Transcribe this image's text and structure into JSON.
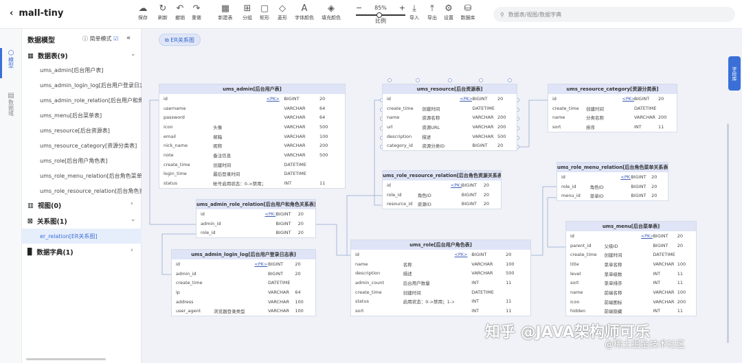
{
  "app": {
    "title": "mall-tiny"
  },
  "toolbar": [
    {
      "label": "保存",
      "icon": "cloud-save-icon",
      "glyph": "☁"
    },
    {
      "label": "刷新",
      "icon": "refresh-icon",
      "glyph": "↻"
    },
    {
      "label": "撤销",
      "icon": "undo-icon",
      "glyph": "↶"
    },
    {
      "label": "重做",
      "icon": "redo-icon",
      "glyph": "↷"
    },
    {
      "label": "新建表",
      "icon": "new-table-icon",
      "glyph": "▦"
    },
    {
      "label": "分组",
      "icon": "group-icon",
      "glyph": "⊞"
    },
    {
      "label": "矩形",
      "icon": "rect-icon",
      "glyph": "▢"
    },
    {
      "label": "菱形",
      "icon": "diamond-icon",
      "glyph": "◇"
    },
    {
      "label": "字体颜色",
      "icon": "font-color-icon",
      "glyph": "A"
    },
    {
      "label": "填充颜色",
      "icon": "fill-color-icon",
      "glyph": "◈"
    },
    {
      "label": "导入",
      "icon": "import-icon",
      "glyph": "⤓"
    },
    {
      "label": "导出",
      "icon": "export-icon",
      "glyph": "⤒"
    },
    {
      "label": "设置",
      "icon": "settings-icon",
      "glyph": "⚙"
    },
    {
      "label": "数据库",
      "icon": "database-icon",
      "glyph": "⛁"
    }
  ],
  "zoom": {
    "value": "85%",
    "label": "比例",
    "minus": "−",
    "plus": "+"
  },
  "search": {
    "placeholder": "数据表/视图/数据字典"
  },
  "rail": {
    "model": "模型",
    "dict": "数据域"
  },
  "panel": {
    "title": "数据模型",
    "simple_mode": "简单模式",
    "tables_section": "数据表(9)",
    "tables": [
      "ums_admin[后台用户表]",
      "ums_admin_login_log[后台用户登录日志表]",
      "ums_admin_role_relation[后台用户和角色关系表]",
      "ums_menu[后台菜单表]",
      "ums_resource[后台资源表]",
      "ums_resource_category[资源分类表]",
      "ums_role[后台用户角色表]",
      "ums_role_menu_relation[后台角色菜单关系表]",
      "ums_role_resource_relation[后台角色资源关系表]"
    ],
    "views_section": "视图(0)",
    "relations_section": "关系图(1)",
    "relations": [
      "er_relation[ER关系图]"
    ],
    "dict_section": "数据字典(1)"
  },
  "canvas": {
    "er_tab": "ER关系图",
    "field_lib": "字段库"
  },
  "watermark": {
    "line1": "知乎 @JAVA架构师可乐",
    "line2": "@稀土掘金技术社区"
  },
  "tables": [
    {
      "name": "ums_admin[后台用户表]",
      "rows": [
        [
          "id",
          "",
          "<PK>",
          "BIGINT",
          "20"
        ],
        [
          "username",
          "",
          "",
          "VARCHAR",
          "64"
        ],
        [
          "password",
          "",
          "",
          "VARCHAR",
          "64"
        ],
        [
          "icon",
          "头像",
          "",
          "VARCHAR",
          "500"
        ],
        [
          "email",
          "邮箱",
          "",
          "VARCHAR",
          "100"
        ],
        [
          "nick_name",
          "昵称",
          "",
          "VARCHAR",
          "200"
        ],
        [
          "note",
          "备注信息",
          "",
          "VARCHAR",
          "500"
        ],
        [
          "create_time",
          "创建时间",
          "",
          "DATETIME",
          ""
        ],
        [
          "login_time",
          "最后登录时间",
          "",
          "DATETIME",
          ""
        ],
        [
          "status",
          "帐号启用状态：0->禁用；1->启用",
          "",
          "INT",
          "11"
        ]
      ]
    },
    {
      "name": "ums_resource[后台资源表]",
      "rows": [
        [
          "id",
          "",
          "<PK>",
          "BIGINT",
          "20"
        ],
        [
          "create_time",
          "创建时间",
          "",
          "DATETIME",
          ""
        ],
        [
          "name",
          "资源名称",
          "",
          "VARCHAR",
          "200"
        ],
        [
          "url",
          "资源URL",
          "",
          "VARCHAR",
          "200"
        ],
        [
          "description",
          "描述",
          "",
          "VARCHAR",
          "500"
        ],
        [
          "category_id",
          "资源分类ID",
          "",
          "BIGINT",
          "20"
        ]
      ]
    },
    {
      "name": "ums_resource_category[资源分类表]",
      "rows": [
        [
          "id",
          "",
          "<PK>",
          "BIGINT",
          "20"
        ],
        [
          "create_time",
          "创建时间",
          "",
          "DATETIME",
          ""
        ],
        [
          "name",
          "分类名称",
          "",
          "VARCHAR",
          "200"
        ],
        [
          "sort",
          "排序",
          "",
          "INT",
          "11"
        ]
      ]
    },
    {
      "name": "ums_role_resource_relation[后台角色资源关系表]",
      "rows": [
        [
          "id",
          "",
          "<PK>",
          "BIGINT",
          "20"
        ],
        [
          "role_id",
          "角色ID",
          "",
          "BIGINT",
          "20"
        ],
        [
          "resource_id",
          "资源ID",
          "",
          "BIGINT",
          "20"
        ]
      ]
    },
    {
      "name": "ums_role_menu_relation[后台角色菜单关系表]",
      "rows": [
        [
          "id",
          "",
          "<PK>",
          "BIGINT",
          "20"
        ],
        [
          "role_id",
          "角色ID",
          "",
          "BIGINT",
          "20"
        ],
        [
          "menu_id",
          "菜单ID",
          "",
          "BIGINT",
          "20"
        ]
      ]
    },
    {
      "name": "ums_admin_role_relation[后台用户和角色关系表]",
      "rows": [
        [
          "id",
          "",
          "<PK>",
          "BIGINT",
          "20"
        ],
        [
          "admin_id",
          "",
          "",
          "BIGINT",
          "20"
        ],
        [
          "role_id",
          "",
          "",
          "BIGINT",
          "20"
        ]
      ]
    },
    {
      "name": "ums_admin_login_log[后台用户登录日志表]",
      "rows": [
        [
          "id",
          "",
          "<PK>",
          "BIGINT",
          "20"
        ],
        [
          "admin_id",
          "",
          "",
          "BIGINT",
          "20"
        ],
        [
          "create_time",
          "",
          "",
          "DATETIME",
          ""
        ],
        [
          "ip",
          "",
          "",
          "VARCHAR",
          "64"
        ],
        [
          "address",
          "",
          "",
          "VARCHAR",
          "100"
        ],
        [
          "user_agent",
          "浏览器登录类型",
          "",
          "VARCHAR",
          "100"
        ]
      ]
    },
    {
      "name": "ums_role[后台用户角色表]",
      "rows": [
        [
          "id",
          "",
          "<PK>",
          "BIGINT",
          "20"
        ],
        [
          "name",
          "名称",
          "",
          "VARCHAR",
          "100"
        ],
        [
          "description",
          "描述",
          "",
          "VARCHAR",
          "500"
        ],
        [
          "admin_count",
          "后台用户数量",
          "",
          "INT",
          "11"
        ],
        [
          "create_time",
          "创建时间",
          "",
          "DATETIME",
          ""
        ],
        [
          "status",
          "启用状态：0->禁用；1->启用",
          "",
          "INT",
          "11"
        ],
        [
          "sort",
          "",
          "",
          "INT",
          "11"
        ]
      ]
    },
    {
      "name": "ums_menu[后台菜单表]",
      "rows": [
        [
          "id",
          "",
          "<PK>",
          "BIGINT",
          "20"
        ],
        [
          "parent_id",
          "父级ID",
          "",
          "BIGINT",
          "20"
        ],
        [
          "create_time",
          "创建时间",
          "",
          "DATETIME",
          ""
        ],
        [
          "title",
          "菜单名称",
          "",
          "VARCHAR",
          "100"
        ],
        [
          "level",
          "菜单级数",
          "",
          "INT",
          "11"
        ],
        [
          "sort",
          "菜单排序",
          "",
          "INT",
          "11"
        ],
        [
          "name",
          "前端名称",
          "",
          "VARCHAR",
          "100"
        ],
        [
          "icon",
          "前端图标",
          "",
          "VARCHAR",
          "200"
        ],
        [
          "hidden",
          "前端隐藏",
          "",
          "INT",
          "11"
        ]
      ]
    }
  ]
}
